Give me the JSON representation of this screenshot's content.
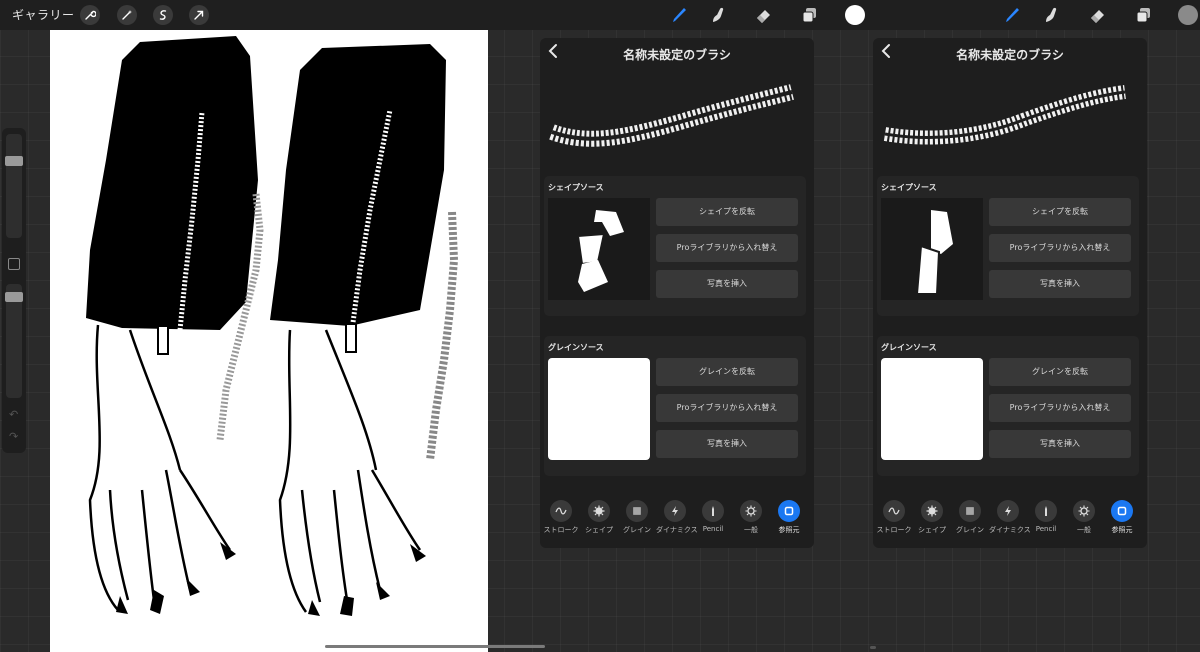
{
  "topbar": {
    "gallery_label": "ギャラリー",
    "left_tools": [
      "wrench-icon",
      "magic-wand-icon",
      "selection-icon",
      "transform-arrow-icon"
    ],
    "right_tools": [
      "brush-icon",
      "smudge-icon",
      "eraser-icon",
      "layers-icon"
    ],
    "color_a": "#ffffff",
    "color_b": "#8a8a8a"
  },
  "panels": [
    {
      "title": "名称未設定のブラシ",
      "shape_section": {
        "title": "シェイプソース",
        "buttons": [
          "シェイプを反転",
          "Proライブラリから入れ替え",
          "写真を挿入"
        ]
      },
      "grain_section": {
        "title": "グレインソース",
        "buttons": [
          "グレインを反転",
          "Proライブラリから入れ替え",
          "写真を挿入"
        ]
      },
      "tabs": [
        "ストローク",
        "シェイプ",
        "グレイン",
        "ダイナミクス",
        "Pencil",
        "一般",
        "参照元"
      ],
      "active_tab": 6
    },
    {
      "title": "名称未設定のブラシ",
      "shape_section": {
        "title": "シェイプソース",
        "buttons": [
          "シェイプを反転",
          "Proライブラリから入れ替え",
          "写真を挿入"
        ]
      },
      "grain_section": {
        "title": "グレインソース",
        "buttons": [
          "グレインを反転",
          "Proライブラリから入れ替え",
          "写真を挿入"
        ]
      },
      "tabs": [
        "ストローク",
        "シェイプ",
        "グレイン",
        "ダイナミクス",
        "Pencil",
        "一般",
        "参照元"
      ],
      "active_tab": 6
    }
  ],
  "accent_color": "#1b78f2"
}
